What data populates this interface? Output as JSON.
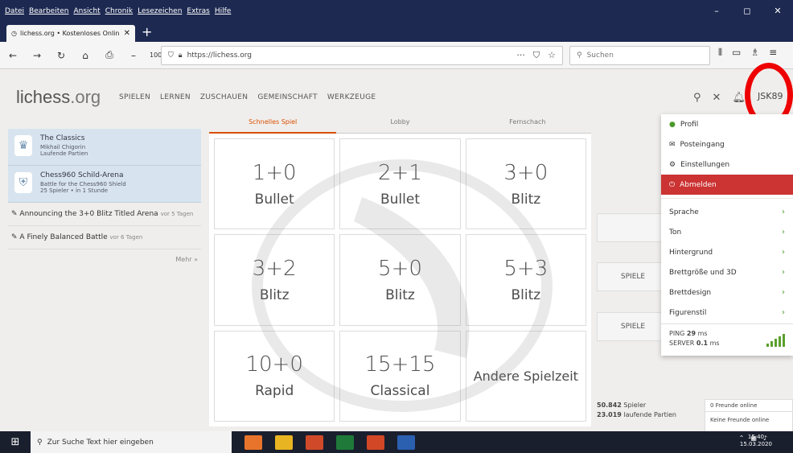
{
  "window": {
    "menu": [
      "Datei",
      "Bearbeiten",
      "Ansicht",
      "Chronik",
      "Lesezeichen",
      "Extras",
      "Hilfe"
    ],
    "controls": [
      "–",
      "◻",
      "✕"
    ]
  },
  "browser": {
    "tab_title": "lichess.org • Kostenloses Onlin",
    "url": "https://lichess.org",
    "zoom": "100%",
    "search_placeholder": "Suchen"
  },
  "site": {
    "logo": "lichess",
    "logo_tld": ".org",
    "nav": [
      "SPIELEN",
      "LERNEN",
      "ZUSCHAUEN",
      "GEMEINSCHAFT",
      "WERKZEUGE"
    ],
    "username": "JSK89"
  },
  "left": {
    "tournaments": [
      {
        "title": "The Classics",
        "line2": "Mikhail Chigorin",
        "line3": "Laufende Partien",
        "icon": "trophy-icon"
      },
      {
        "title": "Chess960 Schild-Arena",
        "line2": "Battle for the Chess960 Shield",
        "line3": "25 Spieler • in 1 Stunde",
        "icon": "shield-icon"
      }
    ],
    "news": [
      {
        "title": "Announcing the 3+0 Blitz Titled Arena",
        "age": "vor 5 Tagen"
      },
      {
        "title": "A Finely Balanced Battle",
        "age": "vor 6 Tagen"
      }
    ],
    "more": "Mehr »"
  },
  "center": {
    "tabs": [
      "Schnelles Spiel",
      "Lobby",
      "Fernschach"
    ],
    "active_tab": 0,
    "pairings": [
      {
        "time": "1+0",
        "type": "Bullet"
      },
      {
        "time": "2+1",
        "type": "Bullet"
      },
      {
        "time": "3+0",
        "type": "Blitz"
      },
      {
        "time": "3+2",
        "type": "Blitz"
      },
      {
        "time": "5+0",
        "type": "Blitz"
      },
      {
        "time": "5+3",
        "type": "Blitz"
      },
      {
        "time": "10+0",
        "type": "Rapid"
      },
      {
        "time": "15+15",
        "type": "Classical"
      }
    ],
    "other": "Andere Spielzeit"
  },
  "right": {
    "btn1": "",
    "btn2": "SPIELE",
    "btn3": "SPIELE",
    "players_count": "50.842",
    "players_label": "Spieler",
    "games_count": "23.019",
    "games_label": "laufende Partien",
    "friends_online": "0 Freunde online",
    "no_friends": "Keine Freunde online"
  },
  "dropdown": {
    "items": [
      "Profil",
      "Posteingang",
      "Einstellungen"
    ],
    "logout": "Abmelden",
    "settings": [
      "Sprache",
      "Ton",
      "Hintergrund",
      "Brettgröße und 3D",
      "Brettdesign",
      "Figurenstil"
    ],
    "ping_label": "PING",
    "ping_value": "29",
    "ping_unit": "ms",
    "server_label": "SERVER",
    "server_value": "0.1",
    "server_unit": "ms"
  },
  "taskbar": {
    "search": "Zur Suche Text hier eingeben",
    "time": "15:40",
    "date": "15.03.2020"
  },
  "colors": {
    "accent": "#d85000",
    "logout": "#cc3333",
    "green": "#4a9a2a",
    "highlight": "#e00000"
  }
}
